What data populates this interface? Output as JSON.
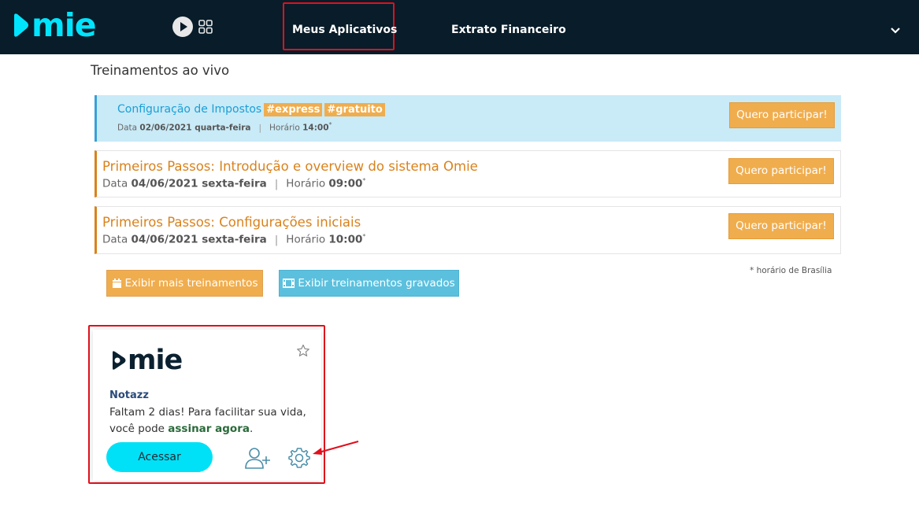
{
  "header": {
    "logo_text": "mie",
    "nav": [
      {
        "label": "Meus Aplicativos"
      },
      {
        "label": "Extrato Financeiro"
      }
    ]
  },
  "training": {
    "section_title": "Treinamentos ao vivo",
    "items": [
      {
        "title": "Configuração de Impostos",
        "tags": [
          "#express",
          "#gratuito"
        ],
        "date_label": "Data",
        "date": "02/06/2021 quarta-feira",
        "time_label": "Horário",
        "time": "14:00",
        "button": "Quero participar!"
      },
      {
        "title": "Primeiros Passos: Introdução e overview do sistema Omie",
        "date_label": "Data",
        "date": "04/06/2021 sexta-feira",
        "time_label": "Horário",
        "time": "09:00",
        "button": "Quero participar!"
      },
      {
        "title": "Primeiros Passos: Configurações iniciais",
        "date_label": "Data",
        "date": "04/06/2021 sexta-feira",
        "time_label": "Horário",
        "time": "10:00",
        "button": "Quero participar!"
      }
    ],
    "time_mark": "*",
    "footnote": "* horário de Brasília",
    "more_button": "Exibir mais treinamentos",
    "recorded_button": "Exibir treinamentos gravados"
  },
  "app_card": {
    "logo_text": "mie",
    "name": "Notazz",
    "message_prefix": "Faltam 2 dias! Para facilitar sua vida, você pode ",
    "message_link": "assinar agora",
    "message_suffix": ".",
    "access_button": "Acessar"
  },
  "colors": {
    "topbar": "#081c29",
    "brand_cyan": "#00e5ff",
    "orange": "#f0ad4e",
    "blue_button": "#5bc0de",
    "highlight_red": "#e0101c"
  }
}
